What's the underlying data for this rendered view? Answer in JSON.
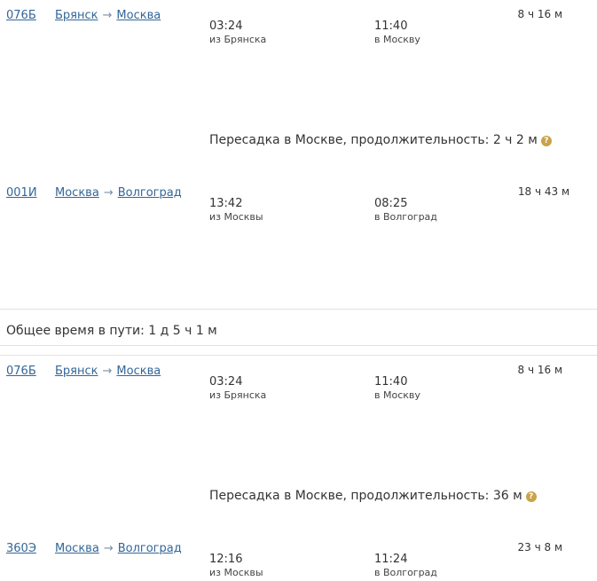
{
  "options": [
    {
      "legs": [
        {
          "train": "076Б",
          "from": "Брянск",
          "to": "Москва",
          "arrow": "→",
          "departure": "03:24",
          "departure_place": "из Брянска",
          "arrival": "11:40",
          "arrival_place": "в Москву",
          "duration": "8 ч 16 м"
        },
        {
          "train": "001И",
          "from": "Москва",
          "to": "Волгоград",
          "arrow": "→",
          "departure": "13:42",
          "departure_place": "из Москвы",
          "arrival": "08:25",
          "arrival_place": "в Волгоград",
          "duration": "18 ч 43 м"
        }
      ],
      "transfer": "Пересадка в Москве, продолжительность: 2 ч 2 м"
    },
    {
      "total": "Общее время в пути: 1 д 5 ч 1 м",
      "legs": [
        {
          "train": "076Б",
          "from": "Брянск",
          "to": "Москва",
          "arrow": "→",
          "departure": "03:24",
          "departure_place": "из Брянска",
          "arrival": "11:40",
          "arrival_place": "в Москву",
          "duration": "8 ч 16 м"
        },
        {
          "train": "360Э",
          "from": "Москва",
          "to": "Волгоград",
          "arrow": "→",
          "departure": "12:16",
          "departure_place": "из Москвы",
          "arrival": "11:24",
          "arrival_place": "в Волгоград",
          "duration": "23 ч 8 м"
        }
      ],
      "transfer": "Пересадка в Москве, продолжительность: 36 м"
    }
  ],
  "help_icon": {
    "name": "question-icon",
    "glyph": "?",
    "color": "#c9a34a"
  },
  "colors": {
    "link": "#336699",
    "text": "#333333",
    "divider": "#e2e2e2"
  }
}
